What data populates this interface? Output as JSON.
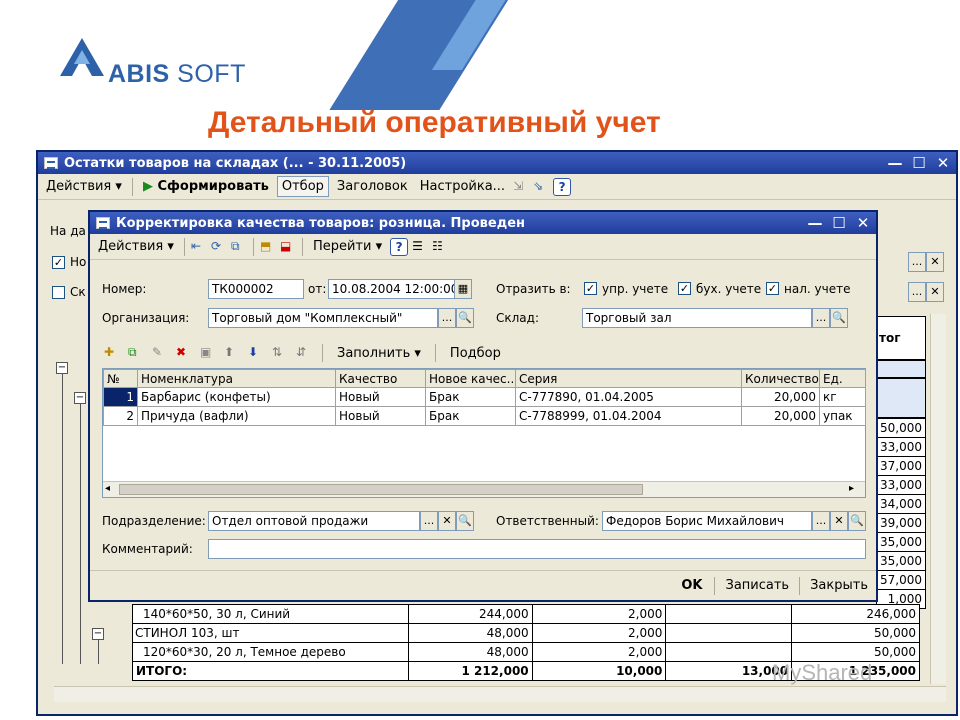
{
  "brand": {
    "name_bold": "ABIS",
    "name_rest": " SOFT"
  },
  "slide_title": "Детальный оперативный учет",
  "back_window": {
    "title": "Остатки товаров на складах (... - 30.11.2005)",
    "toolbar": {
      "actions": "Действия",
      "generate": "Сформировать",
      "filter": "Отбор",
      "header": "Заголовок",
      "settings": "Настройка..."
    },
    "left_labels": {
      "date": "На да",
      "ho": "Но",
      "sk": "Ск"
    },
    "col_header": "тог",
    "right_values": [
      "50,000",
      "33,000",
      "37,000",
      "33,000",
      "34,000",
      "39,000",
      "35,000",
      "35,000",
      "57,000",
      "1,000"
    ],
    "rows": [
      {
        "name": "140*60*50, 30 л, Синий",
        "v1": "244,000",
        "v2": "2,000",
        "v3": "",
        "v4": "246,000"
      },
      {
        "name": "СТИНОЛ 103, шт",
        "v1": "48,000",
        "v2": "2,000",
        "v3": "",
        "v4": "50,000"
      },
      {
        "name": "120*60*30, 20 л, Темное дерево",
        "v1": "48,000",
        "v2": "2,000",
        "v3": "",
        "v4": "50,000"
      },
      {
        "name": "ИТОГО:",
        "v1": "1 212,000",
        "v2": "10,000",
        "v3": "13,000",
        "v4": "1 235,000"
      }
    ]
  },
  "dialog": {
    "title": "Корректировка качества товаров: розница. Проведен",
    "toolbar": {
      "actions": "Действия",
      "goto": "Перейти"
    },
    "number_label": "Номер:",
    "number_value": "ТК000002",
    "from_label": "от:",
    "date_value": "10.08.2004 12:00:00",
    "reflect_label": "Отразить в:",
    "reflect_options": [
      "упр. учете",
      "бух. учете",
      "нал. учете"
    ],
    "org_label": "Организация:",
    "org_value": "Торговый дом \"Комплексный\"",
    "warehouse_label": "Склад:",
    "warehouse_value": "Торговый зал",
    "fill_label": "Заполнить",
    "pick_label": "Подбор",
    "columns": [
      "№",
      "Номенклатура",
      "Качество",
      "Новое качес...",
      "Серия",
      "Количество",
      "Ед."
    ],
    "rows": [
      {
        "n": "1",
        "name": "Барбарис (конфеты)",
        "quality": "Новый",
        "new_quality": "Брак",
        "series": "С-777890, 01.04.2005",
        "qty": "20,000",
        "unit": "кг"
      },
      {
        "n": "2",
        "name": "Причуда (вафли)",
        "quality": "Новый",
        "new_quality": "Брак",
        "series": "С-7788999, 01.04.2004",
        "qty": "20,000",
        "unit": "упак"
      }
    ],
    "dept_label": "Подразделение:",
    "dept_value": "Отдел оптовой продажи",
    "resp_label": "Ответственный:",
    "resp_value": "Федоров Борис Михайлович",
    "comment_label": "Комментарий:",
    "comment_value": "",
    "ok": "OK",
    "save": "Записать",
    "close": "Закрыть"
  },
  "watermark": "MyShared",
  "colors": {
    "title_accent": "#e2531a",
    "brand_blue": "#2e62a8",
    "titlebar": "#1f3e9c"
  }
}
